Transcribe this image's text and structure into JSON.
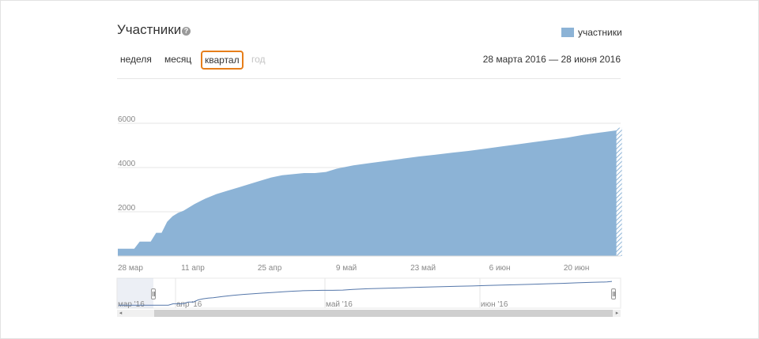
{
  "header": {
    "title": "Участники",
    "help_icon": "?"
  },
  "legend": {
    "label": "участники",
    "color": "#8cb3d6"
  },
  "periods": [
    {
      "label": "неделя",
      "state": "normal"
    },
    {
      "label": "месяц",
      "state": "normal"
    },
    {
      "label": "квартал",
      "state": "active"
    },
    {
      "label": "год",
      "state": "disabled"
    }
  ],
  "date_range": "28 марта 2016 — 28 июня 2016",
  "colors": {
    "area": "#8cb3d6",
    "navigator_line": "#5577aa",
    "active_outline": "#e67e1a"
  },
  "chart_data": {
    "type": "area",
    "series": [
      {
        "name": "участники"
      }
    ],
    "x_ticks": [
      "28 мар",
      "11 апр",
      "25 апр",
      "9 май",
      "23 май",
      "6 июн",
      "20 июн"
    ],
    "y_ticks": [
      "2000",
      "4000",
      "6000"
    ],
    "ylim": [
      0,
      6000
    ],
    "x_days": [
      0,
      2,
      3,
      4,
      6,
      7,
      8,
      9,
      10,
      11,
      12,
      14,
      16,
      18,
      20,
      22,
      24,
      26,
      28,
      30,
      32,
      34,
      36,
      38,
      40,
      43,
      46,
      49,
      52,
      55,
      58,
      61,
      64,
      67,
      70,
      73,
      76,
      79,
      82,
      85,
      88,
      91,
      92
    ],
    "values": [
      330,
      330,
      330,
      650,
      650,
      1050,
      1050,
      1550,
      1800,
      1950,
      2050,
      2350,
      2600,
      2800,
      2950,
      3100,
      3250,
      3400,
      3550,
      3650,
      3700,
      3750,
      3750,
      3800,
      3950,
      4100,
      4200,
      4300,
      4400,
      4500,
      4580,
      4670,
      4750,
      4850,
      4950,
      5050,
      5150,
      5250,
      5350,
      5480,
      5580,
      5680,
      5800
    ],
    "grid": true
  },
  "navigator": {
    "labels": [
      "мар '16",
      "апр '16",
      "май '16",
      "июн '16"
    ]
  },
  "scrollbar": {
    "left_arrow": "◂",
    "right_arrow": "▸"
  }
}
